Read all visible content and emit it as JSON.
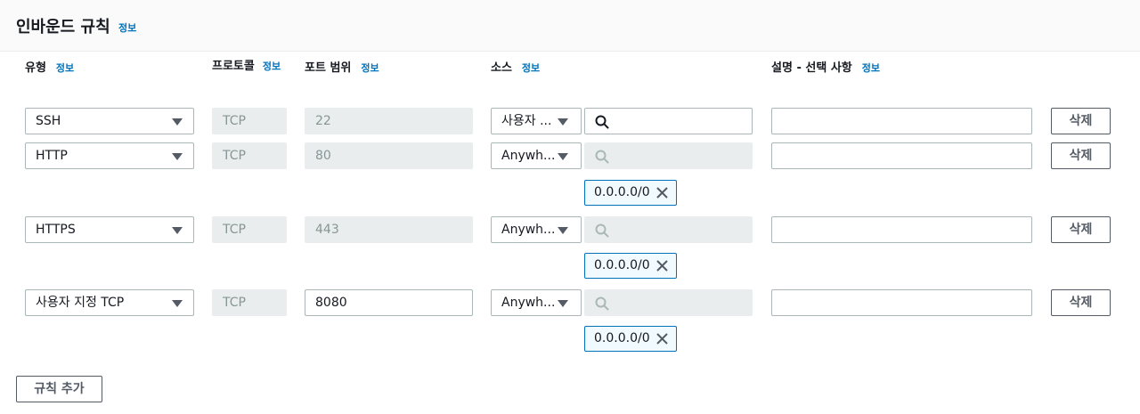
{
  "section": {
    "title": "인바운드 규칙",
    "info": "정보"
  },
  "columns": {
    "type": {
      "label": "유형",
      "info": "정보"
    },
    "protocol": {
      "label": "프로토콜",
      "info": "정보"
    },
    "port_range": {
      "label": "포트 범위",
      "info": "정보"
    },
    "source": {
      "label": "소스",
      "info": "정보"
    },
    "description": {
      "label": "설명 - 선택 사항",
      "info": "정보"
    }
  },
  "rules": [
    {
      "type": "SSH",
      "protocol": "TCP",
      "port": "22",
      "source": "사용자 ...",
      "token": "",
      "delete": "삭제"
    },
    {
      "type": "HTTP",
      "protocol": "TCP",
      "port": "80",
      "source": "Anywh...",
      "token": "0.0.0.0/0",
      "delete": "삭제"
    },
    {
      "type": "HTTPS",
      "protocol": "TCP",
      "port": "443",
      "source": "Anywh...",
      "token": "0.0.0.0/0",
      "delete": "삭제"
    },
    {
      "type": "사용자 지정 TCP",
      "protocol": "TCP",
      "port": "8080",
      "source": "Anywh...",
      "token": "0.0.0.0/0",
      "delete": "삭제"
    }
  ],
  "add_rule": "규칙 추가",
  "colors": {
    "link": "#0073bb",
    "border": "#aab7b8",
    "disabled": "#eaeded",
    "token_bg": "#f1faff"
  }
}
